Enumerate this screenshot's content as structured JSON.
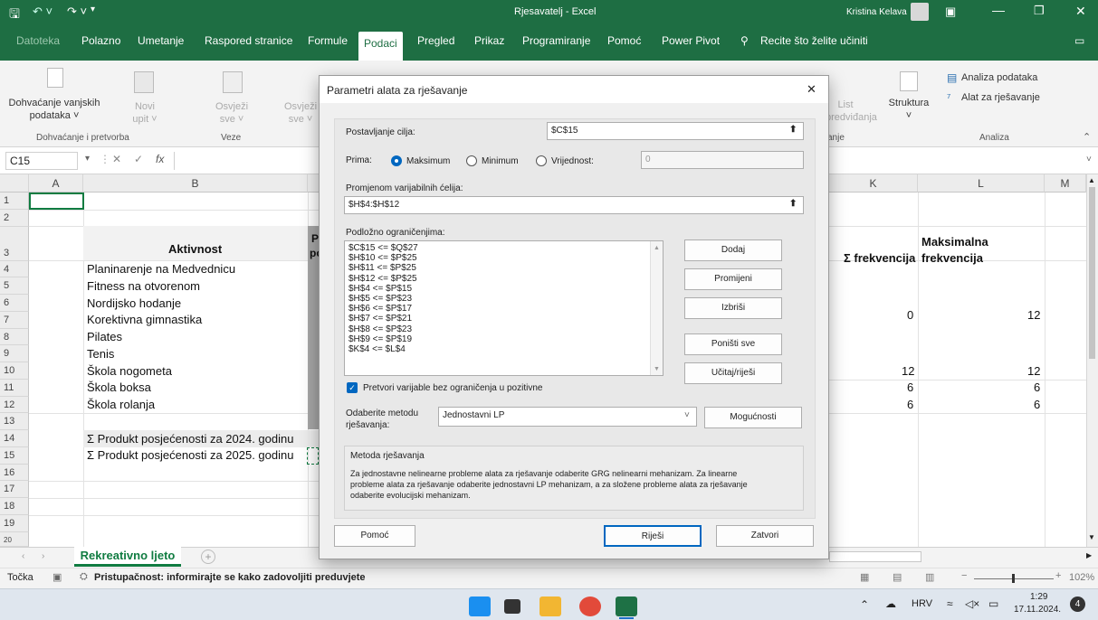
{
  "titlebar": {
    "title": "Rjesavatelj  -  Excel",
    "user": "Kristina Kelava"
  },
  "tabs": [
    "Datoteka",
    "Polazno",
    "Umetanje",
    "Raspored stranice",
    "Formule",
    "Podaci",
    "Pregled",
    "Prikaz",
    "Programiranje",
    "Pomoć",
    "Power Pivot"
  ],
  "tell_me": "Recite što želite učiniti",
  "ribbon": {
    "get_data": "Dohvaćanje vanjskih",
    "get_data2": "podataka ˅",
    "new_query": "Novi",
    "new_query2": "upit ˅",
    "refresh": "Osvježi",
    "refresh2": "sve ˅",
    "refresh_b": "Osvježi",
    "refresh_b2": "sve ˅",
    "group_get": "Dohvaćanje i pretvorba",
    "group_conn": "Veze",
    "list": "List",
    "list2": "predviđanja",
    "forecast_group": "anje",
    "outline": "Struktura",
    "analysis_tools": "Analiza podataka",
    "solver": "Alat za rješavanje",
    "group_analysis": "Analiza"
  },
  "formula": {
    "name_box": "C15",
    "fx": "fx"
  },
  "columns": {
    "A": "A",
    "B": "B",
    "K": "K",
    "L": "L",
    "M": "M"
  },
  "rows": [
    "1",
    "2",
    "3",
    "4",
    "5",
    "6",
    "7",
    "8",
    "9",
    "10",
    "11",
    "12",
    "13",
    "14",
    "15",
    "16",
    "17",
    "18",
    "19",
    "20"
  ],
  "cells": {
    "b3": "Aktivnost",
    "b4": "Planinarenje na Medvednicu",
    "b5": "Fitness na otvorenom",
    "b6": "Nordijsko hodanje",
    "b7": "Korektivna gimnastika",
    "b8": "Pilates",
    "b9": "Tenis",
    "b10": "Škola nogometa",
    "b11": "Škola boksa",
    "b12": "Škola rolanja",
    "b14": "Σ Produkt posjećenosti za 2024. godinu",
    "b15": "Σ Produkt posjećenosti za 2025. godinu",
    "k3": "Σ frekvencija",
    "l3a": "Maksimalna",
    "l3b": "frekvencija",
    "k6": "0",
    "l6": "12",
    "k10": "12",
    "l10": "12",
    "k11": "6",
    "l11": "6",
    "k12": "6",
    "l12": "6",
    "c3a": "P",
    "c3b": "po"
  },
  "sheet_tab": "Rekreativno ljeto",
  "status": {
    "mode": "Točka",
    "accessibility": "Pristupačnost: informirajte se kako zadovoljiti preduvjete",
    "zoom": "102%"
  },
  "taskbar": {
    "lang": "HRV",
    "time": "1:29",
    "date": "17.11.2024.",
    "badge": "4"
  },
  "dialog": {
    "title": "Parametri alata za rješavanje",
    "objective_label": "Postavljanje cilja:",
    "objective_value": "$C$15",
    "to_label": "Prima:",
    "max": "Maksimum",
    "min": "Minimum",
    "value_of": "Vrijednost:",
    "value_input": "0",
    "by_changing_label": "Promjenom varijabilnih ćelija:",
    "by_changing_value": "$H$4:$H$12",
    "subject_label": "Podložno ograničenjima:",
    "constraints": [
      "$C$15 <= $Q$27",
      "$H$10 <= $P$25",
      "$H$11 <= $P$25",
      "$H$12 <= $P$25",
      "$H$4 <= $P$15",
      "$H$5 <= $P$23",
      "$H$6 <= $P$17",
      "$H$7 <= $P$21",
      "$H$8 <= $P$23",
      "$H$9 <= $P$19",
      "$K$4 <= $L$4"
    ],
    "add": "Dodaj",
    "change": "Promijeni",
    "delete": "Izbriši",
    "reset": "Poništi sve",
    "load_save": "Učitaj/riješi",
    "checkbox_label": "Pretvori varijable bez ograničenja u pozitivne",
    "method_label1": "Odaberite metodu",
    "method_label2": "rješavanja:",
    "method_value": "Jednostavni LP",
    "options": "Mogućnosti",
    "method_box_title": "Metoda rješavanja",
    "method_desc1": "Za jednostavne nelinearne probleme alata za rješavanje odaberite GRG nelinearni mehanizam. Za linearne",
    "method_desc2": "probleme alata za rješavanje odaberite jednostavni LP mehanizam, a za složene probleme alata za rješavanje",
    "method_desc3": "odaberite evolucijski mehanizam.",
    "help": "Pomoć",
    "solve": "Riješi",
    "close": "Zatvori",
    "close_x": "✕"
  }
}
